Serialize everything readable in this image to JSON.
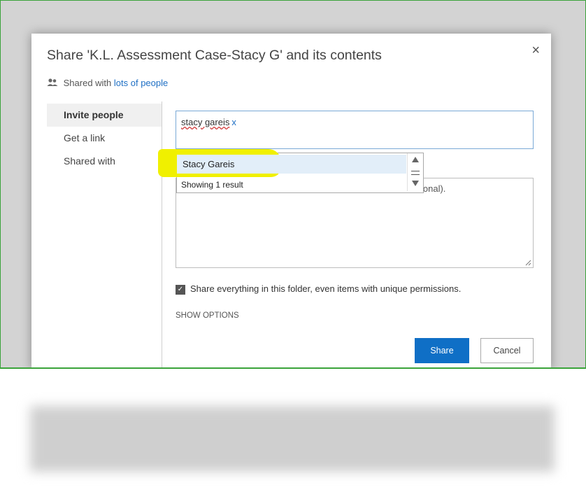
{
  "dialog": {
    "title": "Share 'K.L. Assessment Case-Stacy G' and its contents",
    "close_glyph": "×",
    "shared_prefix": "Shared with",
    "shared_link": "lots of people"
  },
  "nav": {
    "items": [
      {
        "label": "Invite people",
        "active": true
      },
      {
        "label": "Get a link",
        "active": false
      },
      {
        "label": "Shared with",
        "active": false
      }
    ]
  },
  "invite": {
    "token_name": "stacy gareis",
    "token_remove": "x"
  },
  "dropdown": {
    "suggestion": "Stacy Gareis",
    "result_count": "Showing 1 result"
  },
  "message": {
    "placeholder_visible": "ional)."
  },
  "options": {
    "checkbox_label": "Share everything in this folder, even items with unique permissions.",
    "checkbox_checked": true,
    "show_options": "SHOW OPTIONS"
  },
  "buttons": {
    "share": "Share",
    "cancel": "Cancel"
  },
  "colors": {
    "accent": "#0f6fc6",
    "highlight": "#f0f000",
    "frame_border": "#3aa33a"
  },
  "icons": [
    "people-icon",
    "close-icon",
    "scroll-up-icon",
    "scroll-down-icon",
    "check-icon",
    "resize-handle-icon"
  ]
}
